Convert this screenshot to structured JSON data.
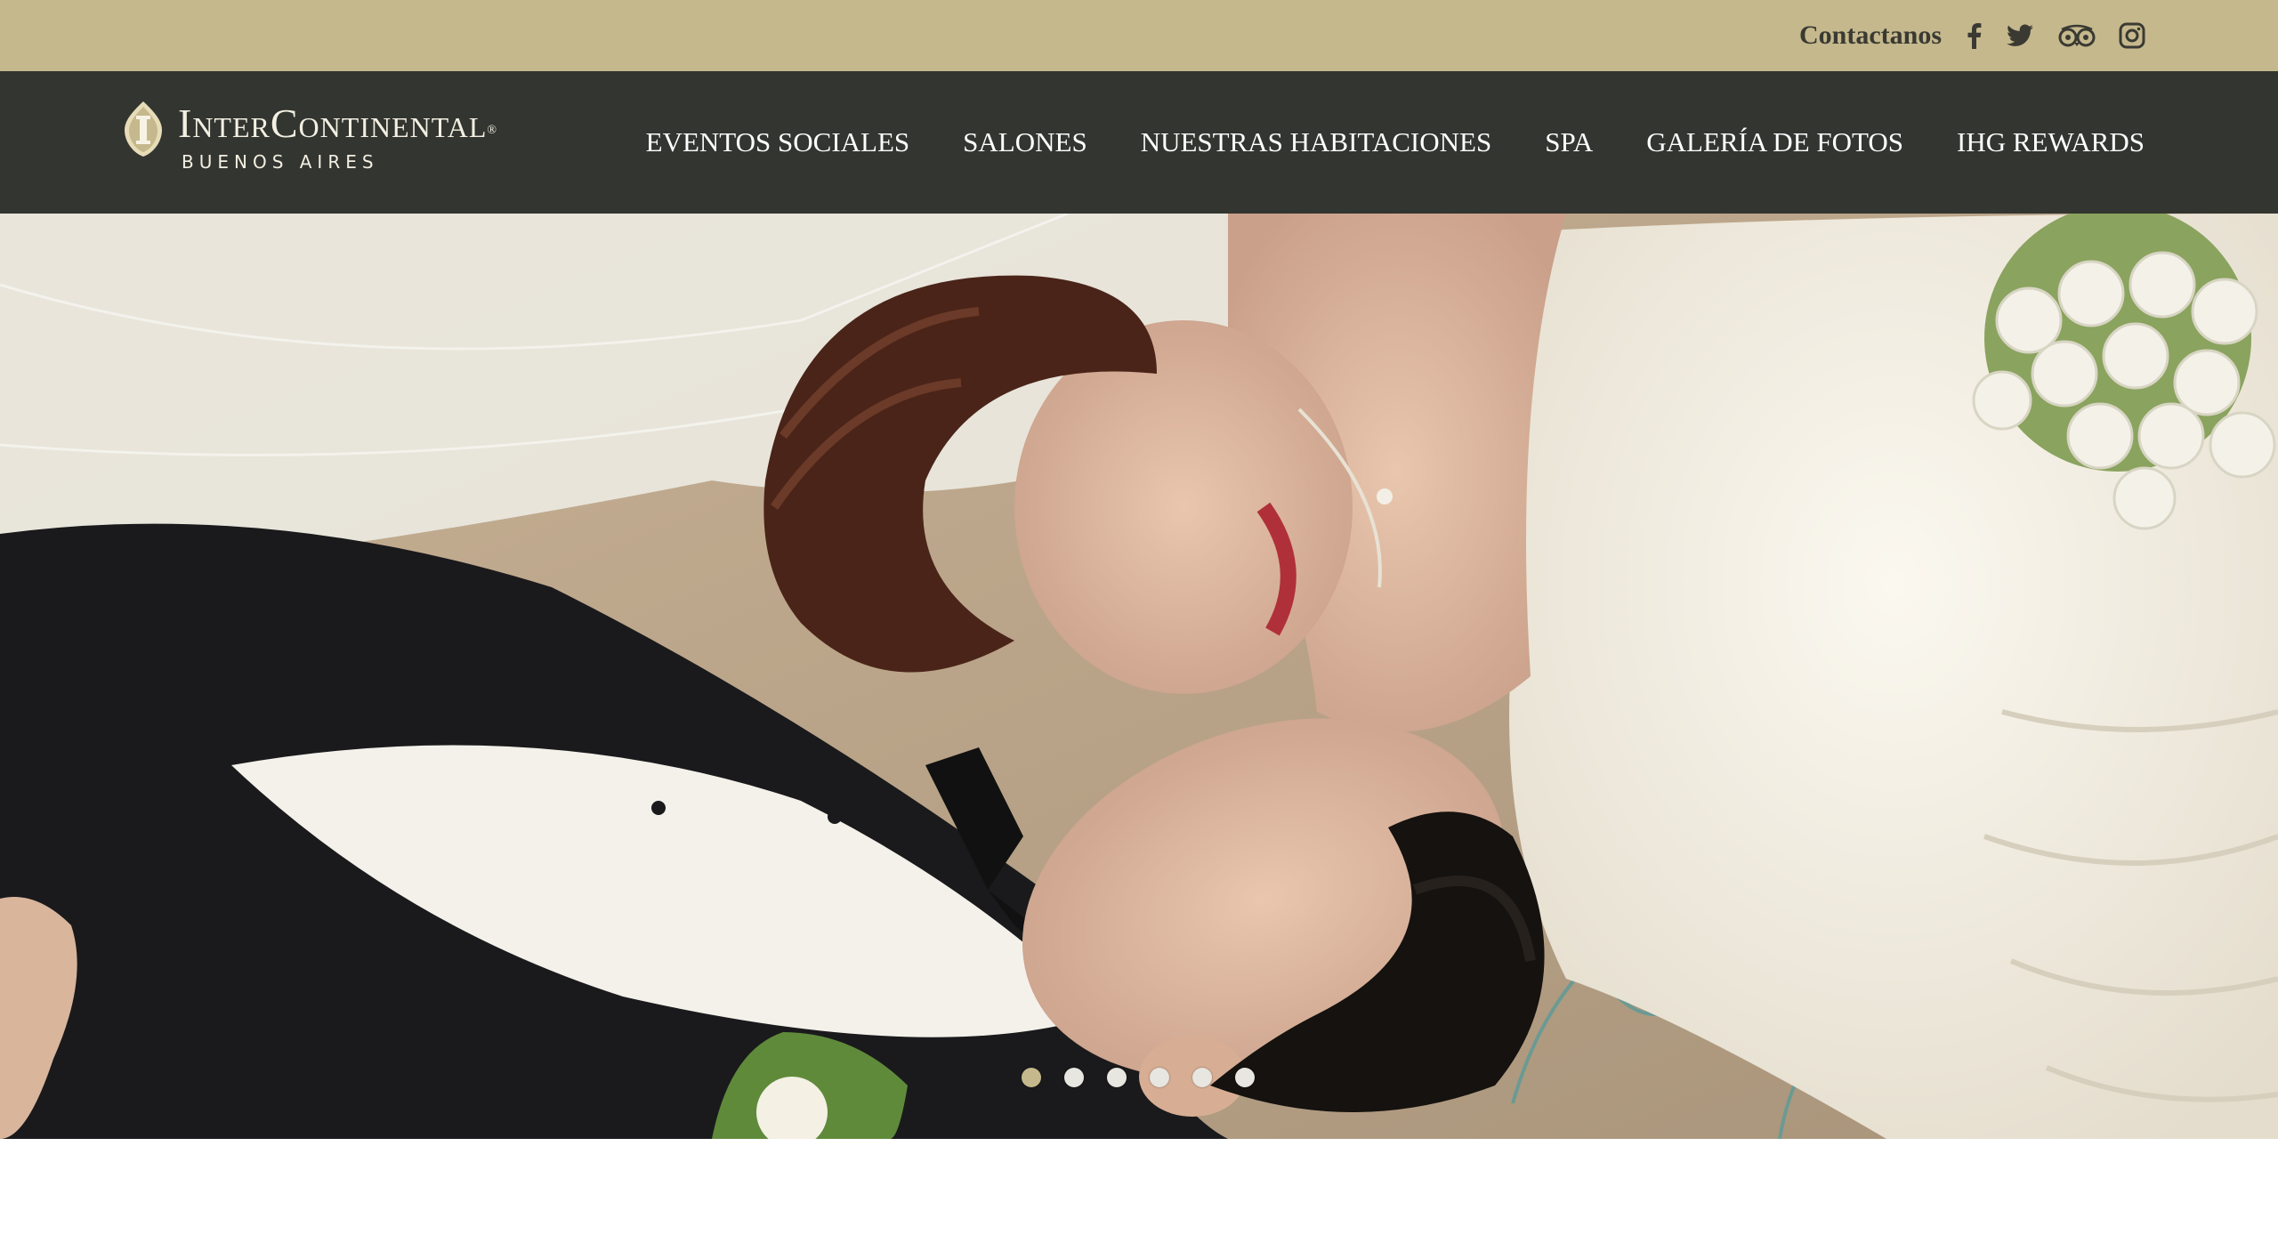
{
  "topbar": {
    "contact_label": "Contactanos",
    "social": [
      "facebook-icon",
      "twitter-icon",
      "tripadvisor-icon",
      "instagram-icon"
    ]
  },
  "logo": {
    "brand": "InterContinental",
    "city": "BUENOS AIRES"
  },
  "nav": {
    "items": [
      {
        "label": "EVENTOS SOCIALES"
      },
      {
        "label": "SALONES"
      },
      {
        "label": "NUESTRAS HABITACIONES"
      },
      {
        "label": "SPA"
      },
      {
        "label": "GALERÍA DE FOTOS"
      },
      {
        "label": "IHG REWARDS"
      }
    ]
  },
  "hero": {
    "image": "wedding-couple-photo",
    "slides_total": 6,
    "active_slide": 1
  },
  "colors": {
    "topbar_bg": "#c5b88c",
    "nav_bg": "#333530",
    "accent": "#c5b88c"
  }
}
